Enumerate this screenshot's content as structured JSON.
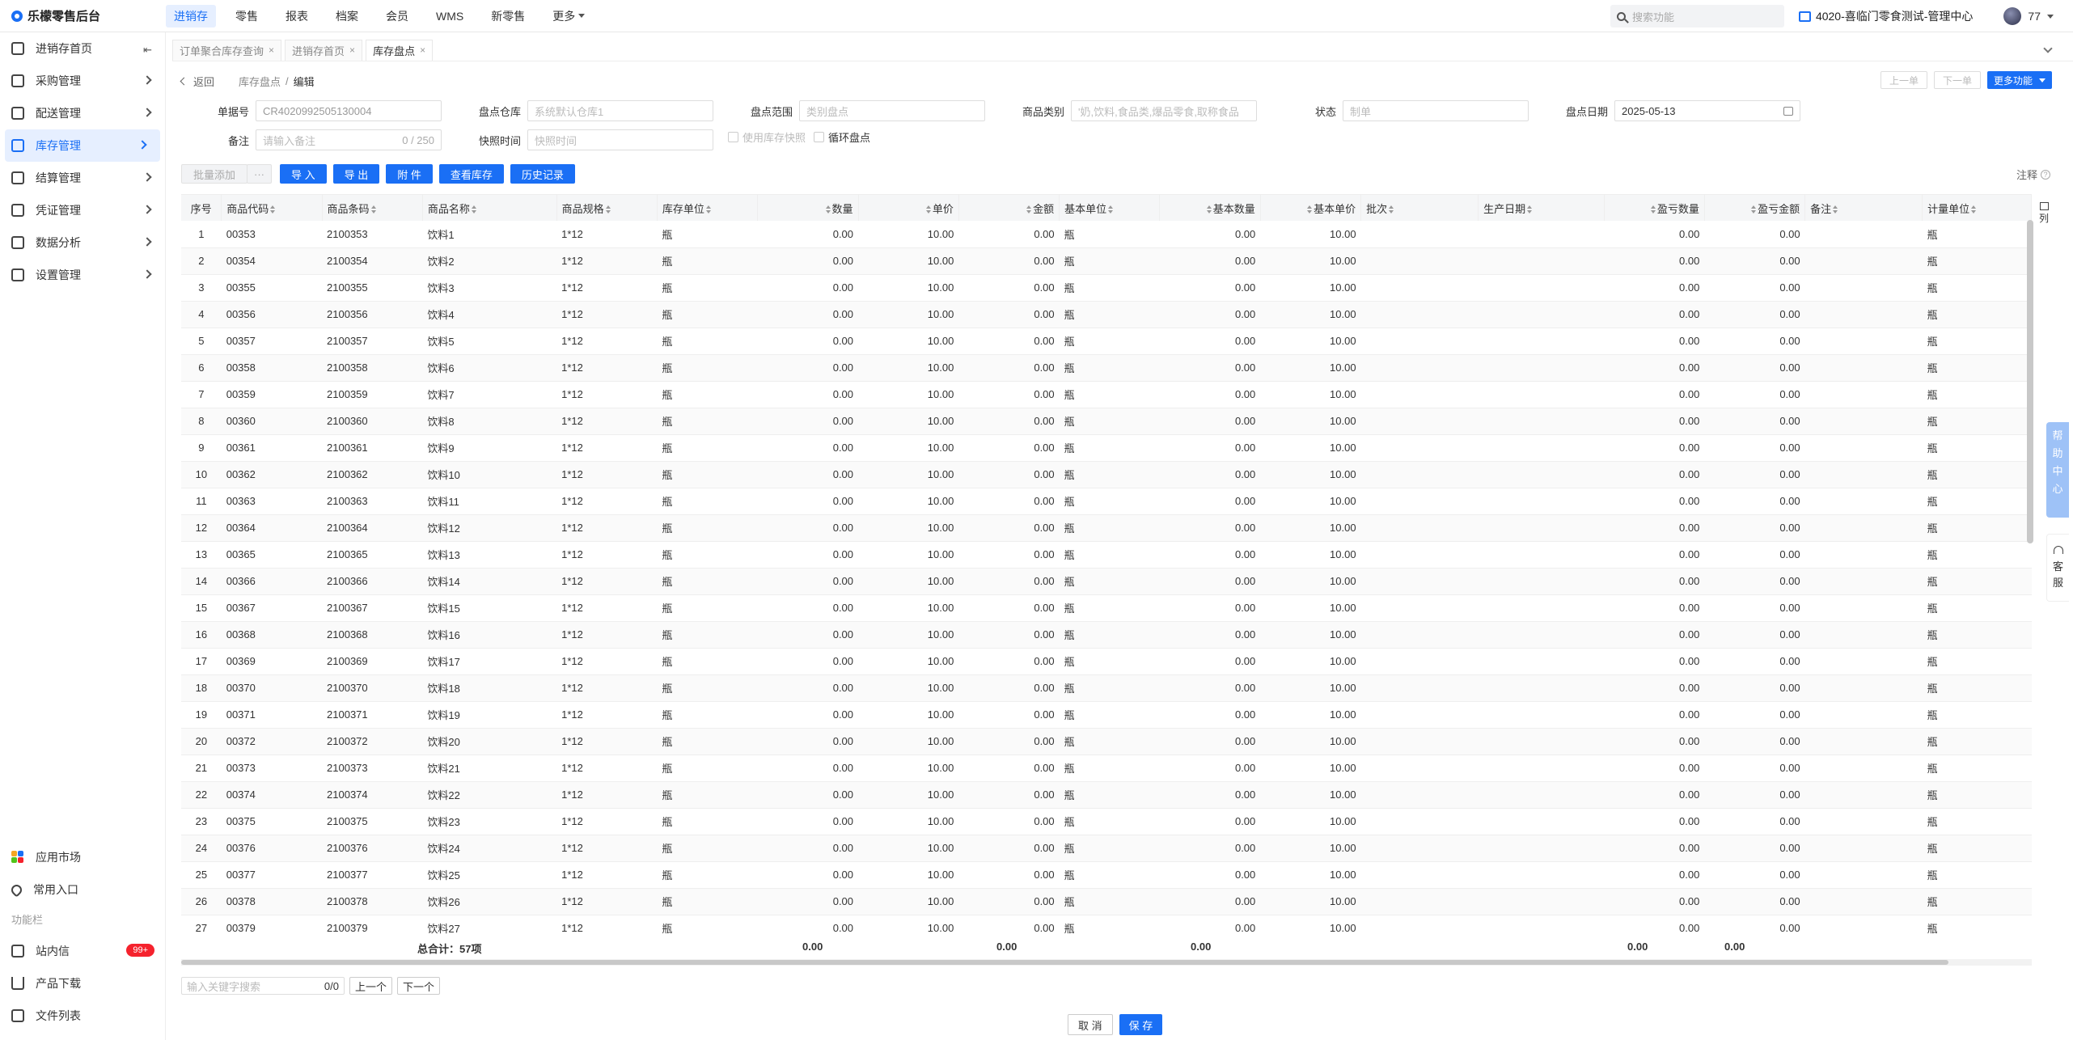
{
  "app": {
    "title": "乐檬零售后台"
  },
  "topnav": [
    {
      "label": "进销存",
      "active": true
    },
    {
      "label": "零售"
    },
    {
      "label": "报表"
    },
    {
      "label": "档案"
    },
    {
      "label": "会员"
    },
    {
      "label": "WMS"
    },
    {
      "label": "新零售"
    },
    {
      "label": "更多",
      "dropdown": true
    }
  ],
  "search": {
    "placeholder": "搜索功能"
  },
  "org": {
    "label": "4020-喜临门零食测试-管理中心"
  },
  "user": {
    "name": "77"
  },
  "sidebar": {
    "items": [
      {
        "label": "进销存首页",
        "icon": "home-icon"
      },
      {
        "label": "采购管理",
        "icon": "cart-icon"
      },
      {
        "label": "配送管理",
        "icon": "truck-icon"
      },
      {
        "label": "库存管理",
        "icon": "inventory-icon",
        "active": true
      },
      {
        "label": "结算管理",
        "icon": "settle-icon"
      },
      {
        "label": "凭证管理",
        "icon": "voucher-icon"
      },
      {
        "label": "数据分析",
        "icon": "chart-icon"
      },
      {
        "label": "设置管理",
        "icon": "settings-icon"
      }
    ],
    "bottom": {
      "market": "应用市场",
      "favorites": "常用入口",
      "section": "功能栏",
      "messages": "站内信",
      "messages_badge": "99+",
      "download": "产品下载",
      "files": "文件列表"
    }
  },
  "tabs": [
    {
      "label": "订单聚合库存查询"
    },
    {
      "label": "进销存首页"
    },
    {
      "label": "库存盘点",
      "active": true
    }
  ],
  "breadcrumb": {
    "back": "返回",
    "parent": "库存盘点",
    "sep": "/",
    "current": "编辑"
  },
  "header_buttons": {
    "prev": "上一单",
    "next": "下一单",
    "more": "更多功能"
  },
  "form": {
    "order_no": {
      "label": "单据号",
      "value": "CR4020992505130004"
    },
    "warehouse": {
      "label": "盘点仓库",
      "placeholder": "系统默认仓库1"
    },
    "scope": {
      "label": "盘点范围",
      "placeholder": "类别盘点"
    },
    "category": {
      "label": "商品类别",
      "placeholder": "'奶,饮料,食品类,爆品零食,取称食品"
    },
    "status": {
      "label": "状态",
      "placeholder": "制单"
    },
    "date": {
      "label": "盘点日期",
      "value": "2025-05-13"
    },
    "remark": {
      "label": "备注",
      "placeholder": "请输入备注",
      "count": "0 / 250"
    },
    "snapshot": {
      "label": "快照时间",
      "placeholder": "快照时间"
    },
    "use_snapshot": "使用库存快照",
    "cyclic": "循环盘点"
  },
  "toolbar": {
    "batch_add": "批量添加",
    "more": "···",
    "import": "导 入",
    "export": "导 出",
    "attach": "附 件",
    "view_stock": "查看库存",
    "history": "历史记录",
    "note": "注释",
    "note_icon": "?"
  },
  "table": {
    "columns": [
      "序号",
      "商品代码",
      "商品条码",
      "商品名称",
      "商品规格",
      "库存单位",
      "数量",
      "单价",
      "金额",
      "基本单位",
      "基本数量",
      "基本单价",
      "批次",
      "生产日期",
      "盈亏数量",
      "盈亏金额",
      "备注",
      "计量单位"
    ],
    "rows": [
      [
        "1",
        "00353",
        "2100353",
        "饮料1",
        "1*12",
        "瓶",
        "0.00",
        "10.00",
        "0.00",
        "瓶",
        "0.00",
        "10.00",
        "",
        "",
        "0.00",
        "0.00",
        "",
        "瓶"
      ],
      [
        "2",
        "00354",
        "2100354",
        "饮料2",
        "1*12",
        "瓶",
        "0.00",
        "10.00",
        "0.00",
        "瓶",
        "0.00",
        "10.00",
        "",
        "",
        "0.00",
        "0.00",
        "",
        "瓶"
      ],
      [
        "3",
        "00355",
        "2100355",
        "饮料3",
        "1*12",
        "瓶",
        "0.00",
        "10.00",
        "0.00",
        "瓶",
        "0.00",
        "10.00",
        "",
        "",
        "0.00",
        "0.00",
        "",
        "瓶"
      ],
      [
        "4",
        "00356",
        "2100356",
        "饮料4",
        "1*12",
        "瓶",
        "0.00",
        "10.00",
        "0.00",
        "瓶",
        "0.00",
        "10.00",
        "",
        "",
        "0.00",
        "0.00",
        "",
        "瓶"
      ],
      [
        "5",
        "00357",
        "2100357",
        "饮料5",
        "1*12",
        "瓶",
        "0.00",
        "10.00",
        "0.00",
        "瓶",
        "0.00",
        "10.00",
        "",
        "",
        "0.00",
        "0.00",
        "",
        "瓶"
      ],
      [
        "6",
        "00358",
        "2100358",
        "饮料6",
        "1*12",
        "瓶",
        "0.00",
        "10.00",
        "0.00",
        "瓶",
        "0.00",
        "10.00",
        "",
        "",
        "0.00",
        "0.00",
        "",
        "瓶"
      ],
      [
        "7",
        "00359",
        "2100359",
        "饮料7",
        "1*12",
        "瓶",
        "0.00",
        "10.00",
        "0.00",
        "瓶",
        "0.00",
        "10.00",
        "",
        "",
        "0.00",
        "0.00",
        "",
        "瓶"
      ],
      [
        "8",
        "00360",
        "2100360",
        "饮料8",
        "1*12",
        "瓶",
        "0.00",
        "10.00",
        "0.00",
        "瓶",
        "0.00",
        "10.00",
        "",
        "",
        "0.00",
        "0.00",
        "",
        "瓶"
      ],
      [
        "9",
        "00361",
        "2100361",
        "饮料9",
        "1*12",
        "瓶",
        "0.00",
        "10.00",
        "0.00",
        "瓶",
        "0.00",
        "10.00",
        "",
        "",
        "0.00",
        "0.00",
        "",
        "瓶"
      ],
      [
        "10",
        "00362",
        "2100362",
        "饮料10",
        "1*12",
        "瓶",
        "0.00",
        "10.00",
        "0.00",
        "瓶",
        "0.00",
        "10.00",
        "",
        "",
        "0.00",
        "0.00",
        "",
        "瓶"
      ],
      [
        "11",
        "00363",
        "2100363",
        "饮料11",
        "1*12",
        "瓶",
        "0.00",
        "10.00",
        "0.00",
        "瓶",
        "0.00",
        "10.00",
        "",
        "",
        "0.00",
        "0.00",
        "",
        "瓶"
      ],
      [
        "12",
        "00364",
        "2100364",
        "饮料12",
        "1*12",
        "瓶",
        "0.00",
        "10.00",
        "0.00",
        "瓶",
        "0.00",
        "10.00",
        "",
        "",
        "0.00",
        "0.00",
        "",
        "瓶"
      ],
      [
        "13",
        "00365",
        "2100365",
        "饮料13",
        "1*12",
        "瓶",
        "0.00",
        "10.00",
        "0.00",
        "瓶",
        "0.00",
        "10.00",
        "",
        "",
        "0.00",
        "0.00",
        "",
        "瓶"
      ],
      [
        "14",
        "00366",
        "2100366",
        "饮料14",
        "1*12",
        "瓶",
        "0.00",
        "10.00",
        "0.00",
        "瓶",
        "0.00",
        "10.00",
        "",
        "",
        "0.00",
        "0.00",
        "",
        "瓶"
      ],
      [
        "15",
        "00367",
        "2100367",
        "饮料15",
        "1*12",
        "瓶",
        "0.00",
        "10.00",
        "0.00",
        "瓶",
        "0.00",
        "10.00",
        "",
        "",
        "0.00",
        "0.00",
        "",
        "瓶"
      ],
      [
        "16",
        "00368",
        "2100368",
        "饮料16",
        "1*12",
        "瓶",
        "0.00",
        "10.00",
        "0.00",
        "瓶",
        "0.00",
        "10.00",
        "",
        "",
        "0.00",
        "0.00",
        "",
        "瓶"
      ],
      [
        "17",
        "00369",
        "2100369",
        "饮料17",
        "1*12",
        "瓶",
        "0.00",
        "10.00",
        "0.00",
        "瓶",
        "0.00",
        "10.00",
        "",
        "",
        "0.00",
        "0.00",
        "",
        "瓶"
      ],
      [
        "18",
        "00370",
        "2100370",
        "饮料18",
        "1*12",
        "瓶",
        "0.00",
        "10.00",
        "0.00",
        "瓶",
        "0.00",
        "10.00",
        "",
        "",
        "0.00",
        "0.00",
        "",
        "瓶"
      ],
      [
        "19",
        "00371",
        "2100371",
        "饮料19",
        "1*12",
        "瓶",
        "0.00",
        "10.00",
        "0.00",
        "瓶",
        "0.00",
        "10.00",
        "",
        "",
        "0.00",
        "0.00",
        "",
        "瓶"
      ],
      [
        "20",
        "00372",
        "2100372",
        "饮料20",
        "1*12",
        "瓶",
        "0.00",
        "10.00",
        "0.00",
        "瓶",
        "0.00",
        "10.00",
        "",
        "",
        "0.00",
        "0.00",
        "",
        "瓶"
      ],
      [
        "21",
        "00373",
        "2100373",
        "饮料21",
        "1*12",
        "瓶",
        "0.00",
        "10.00",
        "0.00",
        "瓶",
        "0.00",
        "10.00",
        "",
        "",
        "0.00",
        "0.00",
        "",
        "瓶"
      ],
      [
        "22",
        "00374",
        "2100374",
        "饮料22",
        "1*12",
        "瓶",
        "0.00",
        "10.00",
        "0.00",
        "瓶",
        "0.00",
        "10.00",
        "",
        "",
        "0.00",
        "0.00",
        "",
        "瓶"
      ],
      [
        "23",
        "00375",
        "2100375",
        "饮料23",
        "1*12",
        "瓶",
        "0.00",
        "10.00",
        "0.00",
        "瓶",
        "0.00",
        "10.00",
        "",
        "",
        "0.00",
        "0.00",
        "",
        "瓶"
      ],
      [
        "24",
        "00376",
        "2100376",
        "饮料24",
        "1*12",
        "瓶",
        "0.00",
        "10.00",
        "0.00",
        "瓶",
        "0.00",
        "10.00",
        "",
        "",
        "0.00",
        "0.00",
        "",
        "瓶"
      ],
      [
        "25",
        "00377",
        "2100377",
        "饮料25",
        "1*12",
        "瓶",
        "0.00",
        "10.00",
        "0.00",
        "瓶",
        "0.00",
        "10.00",
        "",
        "",
        "0.00",
        "0.00",
        "",
        "瓶"
      ],
      [
        "26",
        "00378",
        "2100378",
        "饮料26",
        "1*12",
        "瓶",
        "0.00",
        "10.00",
        "0.00",
        "瓶",
        "0.00",
        "10.00",
        "",
        "",
        "0.00",
        "0.00",
        "",
        "瓶"
      ],
      [
        "27",
        "00379",
        "2100379",
        "饮料27",
        "1*12",
        "瓶",
        "0.00",
        "10.00",
        "0.00",
        "瓶",
        "0.00",
        "10.00",
        "",
        "",
        "0.00",
        "0.00",
        "",
        "瓶"
      ]
    ],
    "totals": {
      "label": "总合计：57项",
      "qty": "0.00",
      "amount": "0.00",
      "base_qty": "0.00",
      "pl_qty": "0.00",
      "pl_amount": "0.00"
    },
    "col_settings": "列"
  },
  "bottom_search": {
    "placeholder": "输入关键字搜索",
    "count": "0/0",
    "prev": "上一个",
    "next": "下一个"
  },
  "footer": {
    "cancel": "取 消",
    "save": "保 存"
  },
  "float": {
    "help": [
      "帮",
      "助",
      "中",
      "心"
    ],
    "service": [
      "客",
      "服"
    ]
  },
  "colors": {
    "primary": "#1a6ff5",
    "badge": "#f5222d"
  }
}
